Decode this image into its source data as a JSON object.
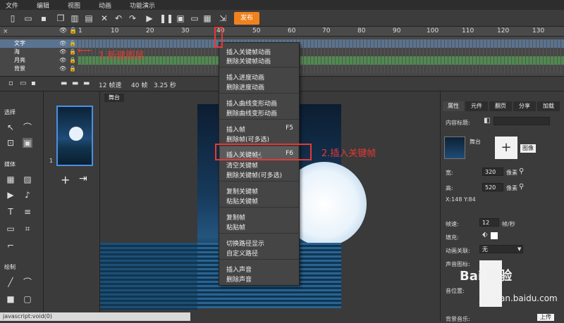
{
  "menu": [
    "文件",
    "编辑",
    "视图",
    "动画",
    "功能演示"
  ],
  "toolbar": {
    "publish_label": "发布"
  },
  "ruler": {
    "ticks": [
      "1",
      "10",
      "20",
      "30",
      "40",
      "50",
      "60",
      "70",
      "80",
      "90",
      "100",
      "110",
      "120",
      "130"
    ]
  },
  "layers": [
    {
      "name": "文字",
      "selected": true
    },
    {
      "name": "海"
    },
    {
      "name": "月亮"
    },
    {
      "name": "背景"
    }
  ],
  "timeline": {
    "fps_label": "12 帧速",
    "frames_label": "40 帧",
    "time_label": "3.25 秒"
  },
  "tools": {
    "select_section": "选择",
    "media_section": "媒体",
    "draw_section": "绘制"
  },
  "pages": {
    "page_number": "1"
  },
  "stage": {
    "tab_label": "舞台"
  },
  "context_menu": [
    {
      "label": "插入关键帧动画"
    },
    {
      "label": "删除关键帧动画"
    },
    {
      "label": "插入进度动画"
    },
    {
      "label": "删除进度动画"
    },
    {
      "label": "插入曲线变形动画"
    },
    {
      "label": "删除曲线变形动画"
    },
    {
      "label": "插入帧",
      "shortcut": "F5"
    },
    {
      "label": "删除帧(可多选)"
    },
    {
      "label": "插入关键帧",
      "shortcut": "F6",
      "highlighted": true
    },
    {
      "label": "清空关键帧"
    },
    {
      "label": "删除关键帧(可多选)"
    },
    {
      "label": "复制关键帧"
    },
    {
      "label": "粘贴关键帧"
    },
    {
      "label": "复制帧"
    },
    {
      "label": "粘贴帧"
    },
    {
      "label": "切换路径显示"
    },
    {
      "label": "自定义路径"
    },
    {
      "label": "插入声音"
    },
    {
      "label": "删除声音"
    }
  ],
  "annotations": {
    "step1": "1.新建图层",
    "step2": "2.插入关键帧"
  },
  "properties": {
    "tabs": [
      "属性",
      "元件",
      "翻页",
      "分享",
      "加载"
    ],
    "content_title_label": "内容标题:",
    "stage_label": "舞台",
    "image_button": "图像",
    "width_label": "宽:",
    "width_value": "320",
    "width_unit": "像素",
    "height_label": "高:",
    "height_value": "520",
    "height_unit": "像素",
    "coords": "X:148    Y:84",
    "fps_label": "帧速:",
    "fps_value": "12",
    "fps_unit": "帧/秒",
    "fill_label": "填充:",
    "anim_link_label": "动画关联:",
    "anim_link_value": "无",
    "sound_icon_label": "声音图标:",
    "position_label": "音位置:",
    "bg_music_label": "背景音乐:",
    "upload_button": "上传"
  },
  "statusbar": {
    "text": "javascript:void(0)"
  },
  "watermark": {
    "brand": "Bai 经验",
    "url": "jingyan.baidu.com"
  }
}
